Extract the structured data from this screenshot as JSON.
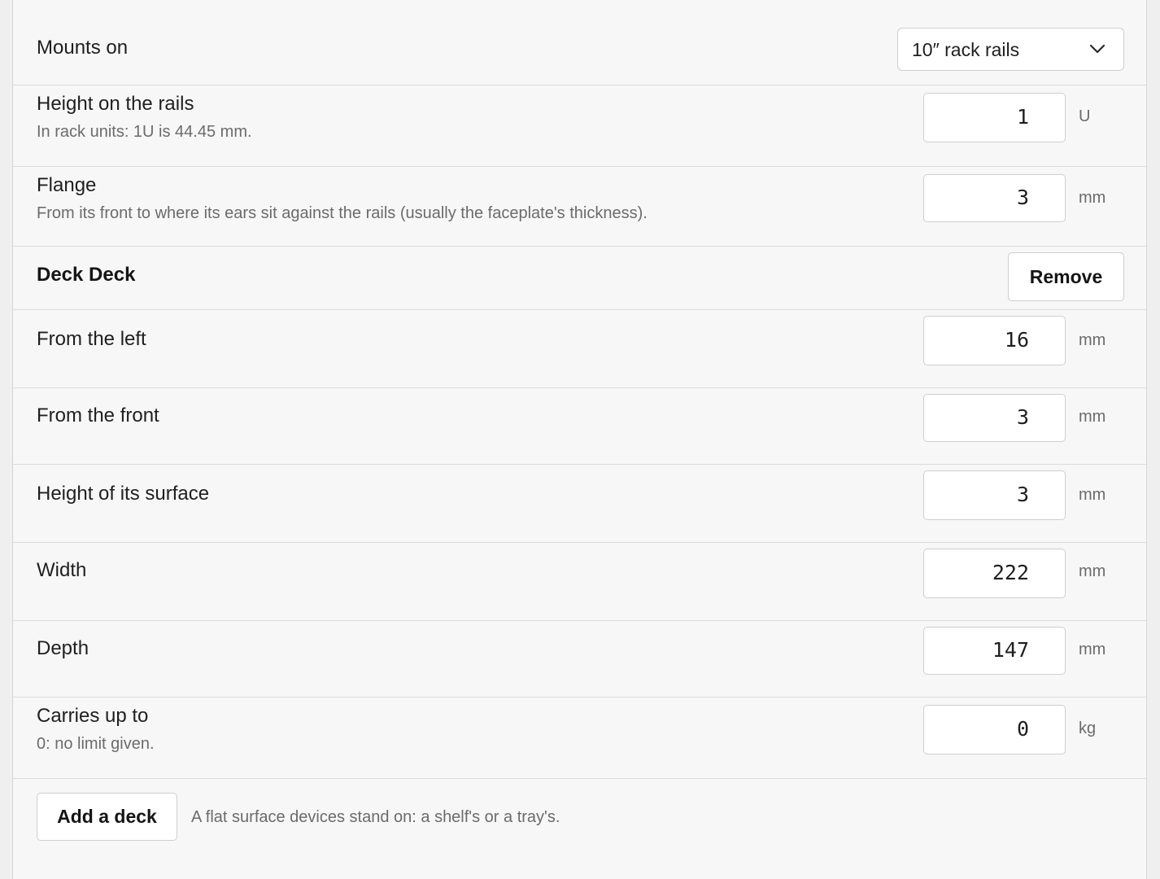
{
  "mounts": {
    "label": "Mounts on",
    "select_value": "10″ rack rails"
  },
  "height_rails": {
    "label": "Height on the rails",
    "hint": "In rack units: 1U is 44.45 mm.",
    "value": "1",
    "unit": "U"
  },
  "flange": {
    "label": "Flange",
    "hint": "From its front to where its ears sit against the rails (usually the faceplate's thickness).",
    "value": "3",
    "unit": "mm"
  },
  "deck": {
    "title": "Deck Deck",
    "remove_label": "Remove",
    "fields": {
      "left": {
        "label": "From the left",
        "value": "16",
        "unit": "mm"
      },
      "front": {
        "label": "From the front",
        "value": "3",
        "unit": "mm"
      },
      "surface": {
        "label": "Height of its surface",
        "value": "3",
        "unit": "mm"
      },
      "width": {
        "label": "Width",
        "value": "222",
        "unit": "mm"
      },
      "depth": {
        "label": "Depth",
        "value": "147",
        "unit": "mm"
      },
      "carries": {
        "label": "Carries up to",
        "hint": "0: no limit given.",
        "value": "0",
        "unit": "kg"
      }
    }
  },
  "add_deck": {
    "button_label": "Add a deck",
    "hint": "A flat surface devices stand on: a shelf's or a tray's."
  }
}
